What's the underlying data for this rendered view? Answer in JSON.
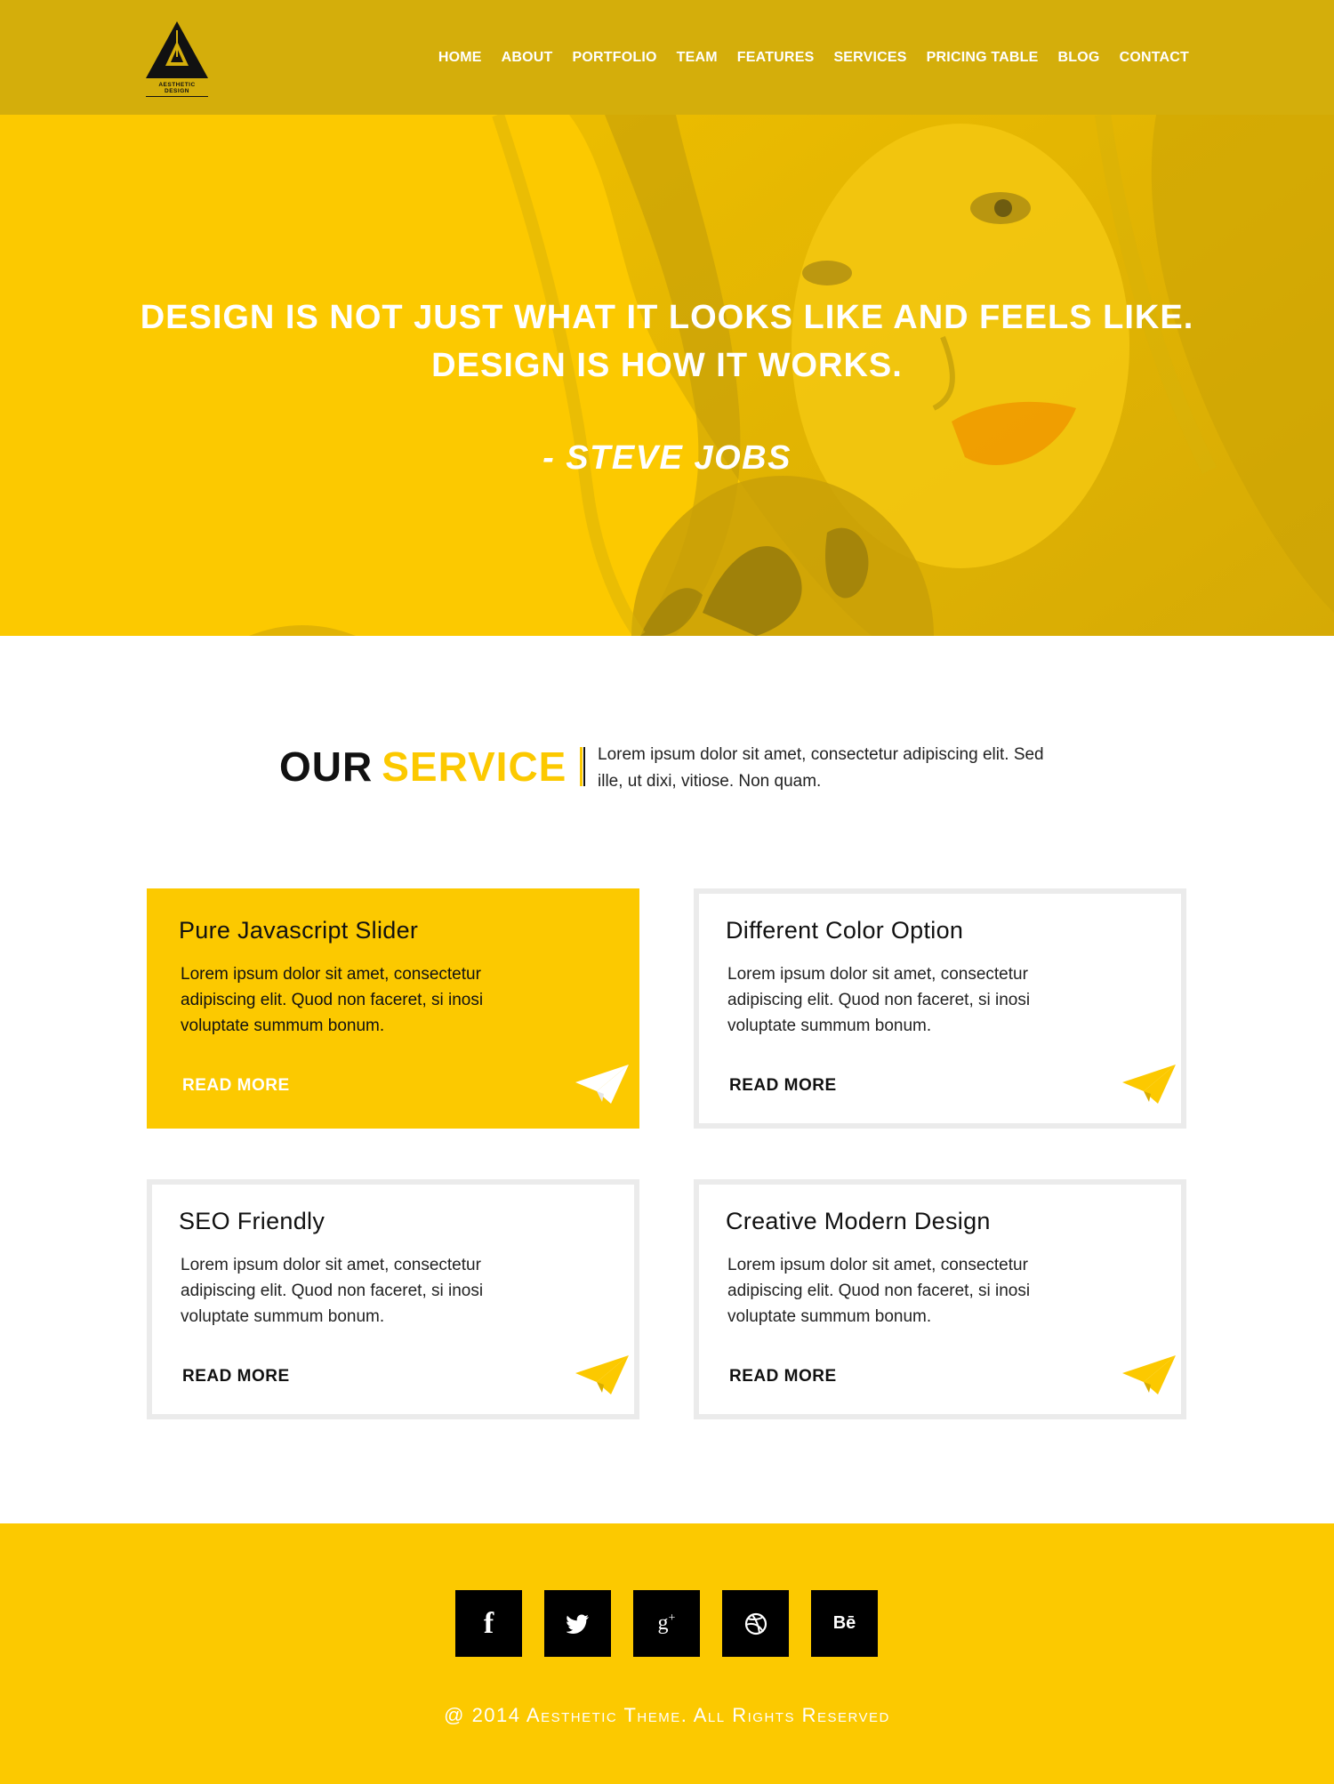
{
  "brand": {
    "logo_text": "AESTHETIC DESIGN",
    "colors": {
      "accent": "#fcc900",
      "header": "#d4ae0b",
      "dark": "#111111",
      "border": "#ebebeb"
    }
  },
  "nav": {
    "items": [
      {
        "label": "HOME"
      },
      {
        "label": "ABOUT"
      },
      {
        "label": "PORTFOLIO"
      },
      {
        "label": "TEAM"
      },
      {
        "label": "FEATURES"
      },
      {
        "label": "SERVICES"
      },
      {
        "label": "PRICING TABLE"
      },
      {
        "label": "BLOG"
      },
      {
        "label": "CONTACT"
      }
    ]
  },
  "hero": {
    "quote_line1": "DESIGN IS NOT JUST WHAT IT LOOKS LIKE AND FEELS LIKE.",
    "quote_line2": "DESIGN IS HOW IT WORKS.",
    "author": "- STEVE JOBS"
  },
  "services": {
    "heading_word1": "OUR",
    "heading_word2": "SERVICE",
    "intro": "Lorem ipsum dolor sit amet, consectetur adipiscing elit. Sed ille, ut dixi, vitiose. Non quam.",
    "cards": [
      {
        "title": "Pure Javascript Slider",
        "text": "Lorem ipsum dolor sit amet, consectetur adipiscing elit. Quod non faceret, si inosi voluptate summum bonum.",
        "link": "READ MORE",
        "icon": "paper-plane-icon"
      },
      {
        "title": "Different Color Option",
        "text": "Lorem ipsum dolor sit amet, consectetur adipiscing elit. Quod non faceret, si inosi voluptate summum bonum.",
        "link": "READ MORE",
        "icon": "paper-plane-icon"
      },
      {
        "title": "SEO Friendly",
        "text": "Lorem ipsum dolor sit amet, consectetur adipiscing elit. Quod non faceret, si inosi voluptate summum bonum.",
        "link": "READ MORE",
        "icon": "paper-plane-icon"
      },
      {
        "title": "Creative Modern Design",
        "text": "Lorem ipsum dolor sit amet, consectetur adipiscing elit. Quod non faceret, si inosi voluptate summum bonum.",
        "link": "READ MORE",
        "icon": "paper-plane-icon"
      }
    ]
  },
  "footer": {
    "social": [
      {
        "name": "facebook-icon",
        "glyph": "f"
      },
      {
        "name": "twitter-icon",
        "glyph": "twitter"
      },
      {
        "name": "google-plus-icon",
        "glyph": "g+"
      },
      {
        "name": "dribbble-icon",
        "glyph": "dribbble"
      },
      {
        "name": "behance-icon",
        "glyph": "Bē"
      }
    ],
    "copyright": "@ 2014 Aesthetic Theme. All Rights Reserved"
  }
}
